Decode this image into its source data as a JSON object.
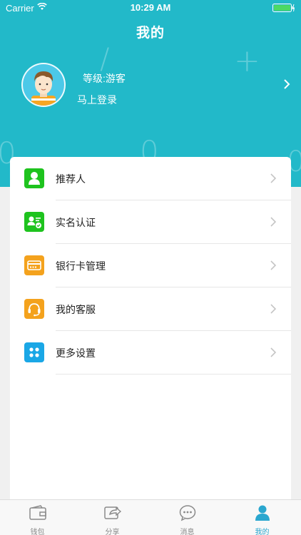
{
  "status_bar": {
    "carrier": "Carrier",
    "time": "10:29 AM"
  },
  "header": {
    "title": "我的"
  },
  "profile": {
    "level": "等级:游客",
    "login": "马上登录"
  },
  "menu": [
    {
      "label": "推荐人",
      "icon": "referrer-icon",
      "color": "#1ec31e"
    },
    {
      "label": "实名认证",
      "icon": "verify-id-icon",
      "color": "#1ec31e"
    },
    {
      "label": "银行卡管理",
      "icon": "bank-card-icon",
      "color": "#f4a21d"
    },
    {
      "label": "我的客服",
      "icon": "headset-icon",
      "color": "#f4a21d"
    },
    {
      "label": "更多设置",
      "icon": "settings-grid-icon",
      "color": "#1aa7e6"
    }
  ],
  "tabs": [
    {
      "label": "钱包",
      "icon": "wallet-icon",
      "active": false
    },
    {
      "label": "分享",
      "icon": "share-icon",
      "active": false
    },
    {
      "label": "消息",
      "icon": "message-icon",
      "active": false
    },
    {
      "label": "我的",
      "icon": "user-icon",
      "active": true
    }
  ],
  "colors": {
    "accent": "#22b9c9",
    "tab_active": "#2aa7cf"
  }
}
